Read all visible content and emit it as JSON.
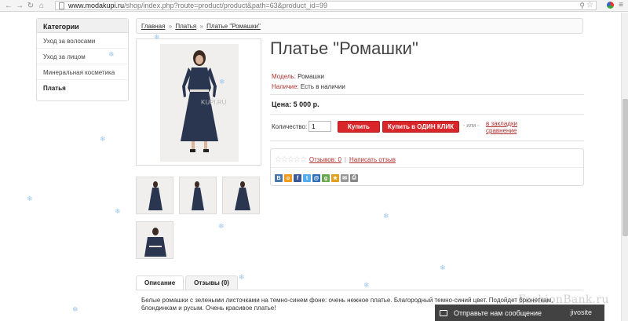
{
  "browser": {
    "url_host": "www.modakupi.ru",
    "url_path": "/shop/index.php?route=product/product&path=63&product_id=99"
  },
  "sidebar": {
    "title": "Категории",
    "items": [
      {
        "label": "Уход за волосами"
      },
      {
        "label": "Уход за лицом"
      },
      {
        "label": "Минеральная косметика"
      },
      {
        "label": "Платья"
      }
    ]
  },
  "breadcrumb": {
    "home": "Главная",
    "category": "Платья",
    "current": "Платье \"Ромашки\"",
    "separator": "»"
  },
  "product": {
    "title": "Платье \"Ромашки\"",
    "model_label": "Модель:",
    "model_value": "Ромашки",
    "availability_label": "Наличие:",
    "availability_value": "Есть в наличии",
    "price": "Цена: 5 000 р.",
    "quantity_label": "Количество:",
    "quantity_value": "1",
    "buy_label": "Купить",
    "one_click_label": "Купить в ОДИН КЛИК",
    "or_label": "- или -",
    "bookmark_label": "в закладки",
    "compare_label": "сравнение",
    "image_watermark": "KUPI.RU"
  },
  "reviews": {
    "rating": 0,
    "reviews_link": "Отзывов: 0",
    "separator": "|",
    "write_link": "Написать отзыв"
  },
  "share_icons": [
    {
      "name": "vk-icon",
      "glyph": "B",
      "color": "#4a76a8"
    },
    {
      "name": "odnoklassniki-icon",
      "glyph": "o",
      "color": "#f59a1a"
    },
    {
      "name": "facebook-icon",
      "glyph": "f",
      "color": "#3b5998"
    },
    {
      "name": "twitter-icon",
      "glyph": "t",
      "color": "#55acee"
    },
    {
      "name": "moimir-icon",
      "glyph": "@",
      "color": "#2f6fb5"
    },
    {
      "name": "google-icon",
      "glyph": "g",
      "color": "#6aa84f"
    },
    {
      "name": "livejournal-icon",
      "glyph": "★",
      "color": "#e0a020"
    },
    {
      "name": "mail-icon",
      "glyph": "✉",
      "color": "#999999"
    },
    {
      "name": "print-icon",
      "glyph": "⎙",
      "color": "#888888"
    }
  ],
  "tabs": [
    {
      "label": "Описание"
    },
    {
      "label": "Отзывы (0)"
    }
  ],
  "description": "Белые ромашки с зелеными листочками на темно-синем фоне: очень нежное платье. Благородный темно-синий цвет. Подойдет брюнеткам, блондинкам и русым. Очень красивое платье!",
  "chat": {
    "label": "Отправьте нам сообщение",
    "brand": "jivosite"
  },
  "watermark": "FashionBank.ru",
  "colors": {
    "accent": "#d9262a",
    "link": "#b03030",
    "chat_bg": "#424242"
  }
}
